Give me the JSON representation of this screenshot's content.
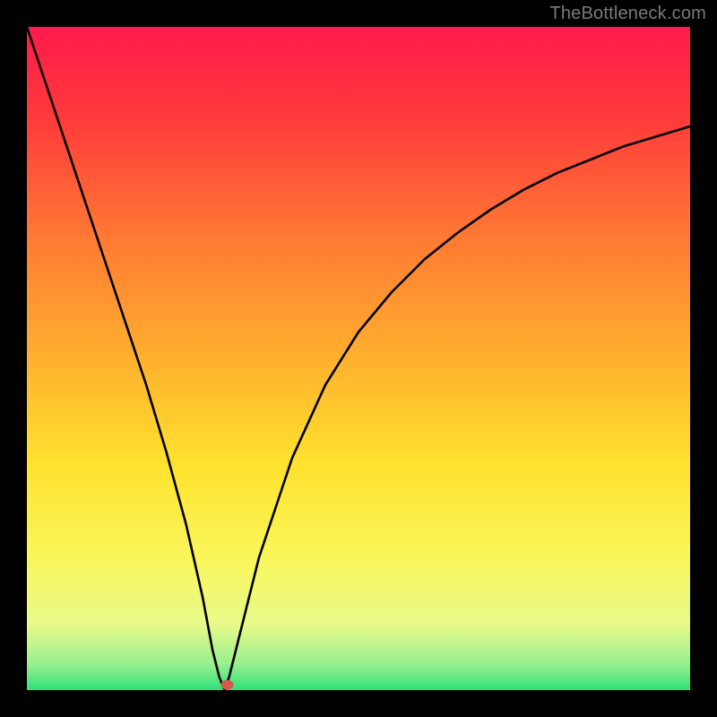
{
  "watermark": "TheBottleneck.com",
  "colors": {
    "frame": "#000000",
    "curve_stroke": "#000000",
    "dot": "#d6564a",
    "watermark": "#7a7a7a"
  },
  "gradient_stops": [
    {
      "pct": 0,
      "color": "#ff1a4b"
    },
    {
      "pct": 14,
      "color": "#ff3b3b"
    },
    {
      "pct": 32,
      "color": "#ff7a33"
    },
    {
      "pct": 50,
      "color": "#ffb02e"
    },
    {
      "pct": 66,
      "color": "#ffe22e"
    },
    {
      "pct": 80,
      "color": "#f9f65a"
    },
    {
      "pct": 90,
      "color": "#e8fa8a"
    },
    {
      "pct": 96,
      "color": "#9af08f"
    },
    {
      "pct": 100,
      "color": "#2fe07a"
    }
  ],
  "chart_data": {
    "type": "line",
    "title": "",
    "xlabel": "",
    "ylabel": "",
    "xlim": [
      0,
      100
    ],
    "ylim": [
      0,
      100
    ],
    "grid": false,
    "series": [
      {
        "name": "bottleneck-curve",
        "style": "line",
        "x": [
          0,
          3,
          6,
          9,
          12,
          15,
          18,
          21,
          24,
          26.5,
          28,
          29,
          29.8,
          30.5,
          35,
          40,
          45,
          50,
          55,
          60,
          65,
          70,
          75,
          80,
          85,
          90,
          95,
          100
        ],
        "y": [
          100,
          91,
          82,
          73,
          64,
          55,
          46,
          36,
          25,
          14,
          6,
          2,
          0,
          2,
          20,
          35,
          46,
          54,
          60,
          65,
          69,
          72.5,
          75.5,
          78,
          80,
          82,
          83.5,
          85
        ]
      },
      {
        "name": "optimal-point",
        "style": "point",
        "x": [
          30.2
        ],
        "y": [
          0.8
        ]
      }
    ]
  }
}
